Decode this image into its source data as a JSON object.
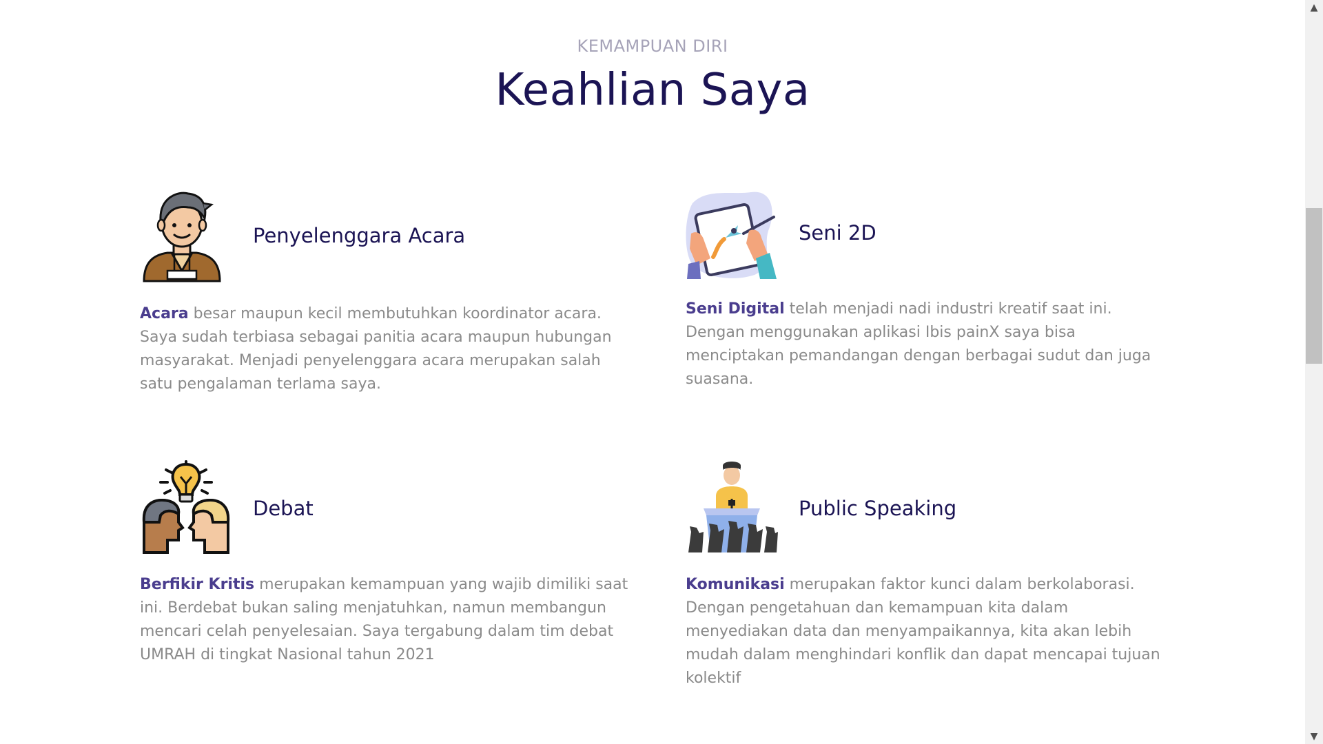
{
  "section": {
    "kicker": "KEMAMPUAN DIRI",
    "title": "Keahlian Saya"
  },
  "skills": [
    {
      "icon": "event-organizer-icon",
      "heading": "Penyelenggara Acara",
      "lead": "Acara",
      "text": " besar maupun kecil membutuhkan koordinator acara. Saya sudah terbiasa sebagai panitia acara maupun hubungan masyarakat. Menjadi penyelenggara acara merupakan salah satu pengalaman terlama saya."
    },
    {
      "icon": "digital-art-tablet-icon",
      "heading": "Seni 2D",
      "lead": "Seni Digital",
      "text": " telah menjadi nadi industri kreatif saat ini. Dengan menggunakan aplikasi Ibis painX saya bisa menciptakan pemandangan dengan berbagai sudut dan juga suasana."
    },
    {
      "icon": "debate-lightbulb-icon",
      "heading": "Debat",
      "lead": "Berfikir Kritis",
      "text": " merupakan kemampuan yang wajib dimiliki saat ini. Berdebat bukan saling menjatuhkan, namun membangun mencari celah penyelesaian. Saya tergabung dalam tim debat UMRAH di tingkat Nasional tahun 2021"
    },
    {
      "icon": "public-speaker-podium-icon",
      "heading": "Public Speaking",
      "lead": "Komunikasi",
      "text": " merupakan faktor kunci dalam berkolaborasi. Dengan pengetahuan dan kemampuan kita dalam menyediakan data dan menyampaikannya, kita akan lebih mudah dalam menghindari konflik dan dapat mencapai tujuan kolektif"
    }
  ],
  "scrollbar": {
    "up_arrow": "▲",
    "down_arrow": "▼",
    "position": 0.28
  },
  "colors": {
    "title": "#1b1454",
    "kicker": "#a6a3b8",
    "lead": "#4a3d8e",
    "body_text": "#8a8a8a"
  }
}
